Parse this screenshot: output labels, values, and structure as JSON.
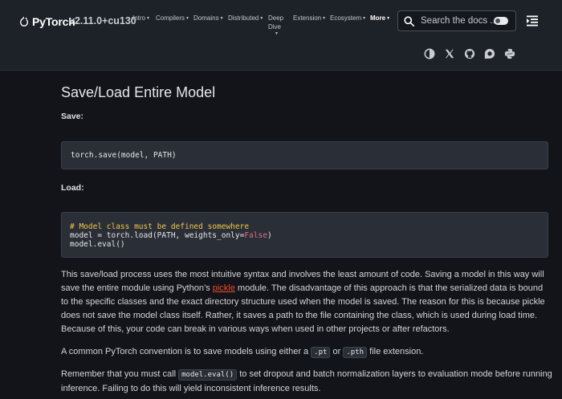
{
  "header": {
    "logo_text": "PyTorch",
    "version": "v2.11.0+cu130",
    "nav": [
      {
        "label": "Intro"
      },
      {
        "label": "Compilers"
      },
      {
        "label": "Domains"
      },
      {
        "label": "Distributed"
      },
      {
        "label_line1": "Deep",
        "label_line2": "Dive"
      },
      {
        "label": "Extension"
      },
      {
        "label": "Ecosystem"
      },
      {
        "label": "More"
      }
    ],
    "search_placeholder": "Search the docs ...",
    "social_icons": [
      "theme-contrast-icon",
      "x-twitter-icon",
      "github-icon",
      "discourse-icon",
      "python-icon"
    ]
  },
  "content": {
    "title": "Save/Load Entire Model",
    "save_label": "Save:",
    "save_code": "torch.save(model, PATH)",
    "load_label": "Load:",
    "load_code": {
      "comment": "# Model class must be defined somewhere",
      "line2_pre": "model = torch.load(PATH, weights_only=",
      "line2_kw": "False",
      "line2_post": ")",
      "line3": "model.eval()"
    },
    "p1": {
      "before_link": "This save/load process uses the most intuitive syntax and involves the least amount of code. Saving a model in this way will save the entire module using Python’s ",
      "link": "pickle",
      "after_link": " module. The disadvantage of this approach is that the serialized data is bound to the specific classes and the exact directory structure used when the model is saved. The reason for this is because pickle does not save the model class itself. Rather, it saves a path to the file containing the class, which is used during load time. Because of this, your code can break in various ways when used in other projects or after refactors."
    },
    "p2": {
      "before": "A common PyTorch convention is to save models using either a ",
      "code1": ".pt",
      "mid": " or ",
      "code2": ".pth",
      "after": " file extension."
    },
    "p3": {
      "before": "Remember that you must call ",
      "code": "model.eval()",
      "after": " to set dropout and batch normalization layers to evaluation mode before running inference. Failing to do this will yield inconsistent inference results."
    }
  },
  "colors": {
    "accent": "#ee4c2c",
    "header_bg": "#1d2128",
    "page_bg": "#12141a",
    "code_bg": "#2a2e36",
    "comment": "#f2c94c"
  }
}
